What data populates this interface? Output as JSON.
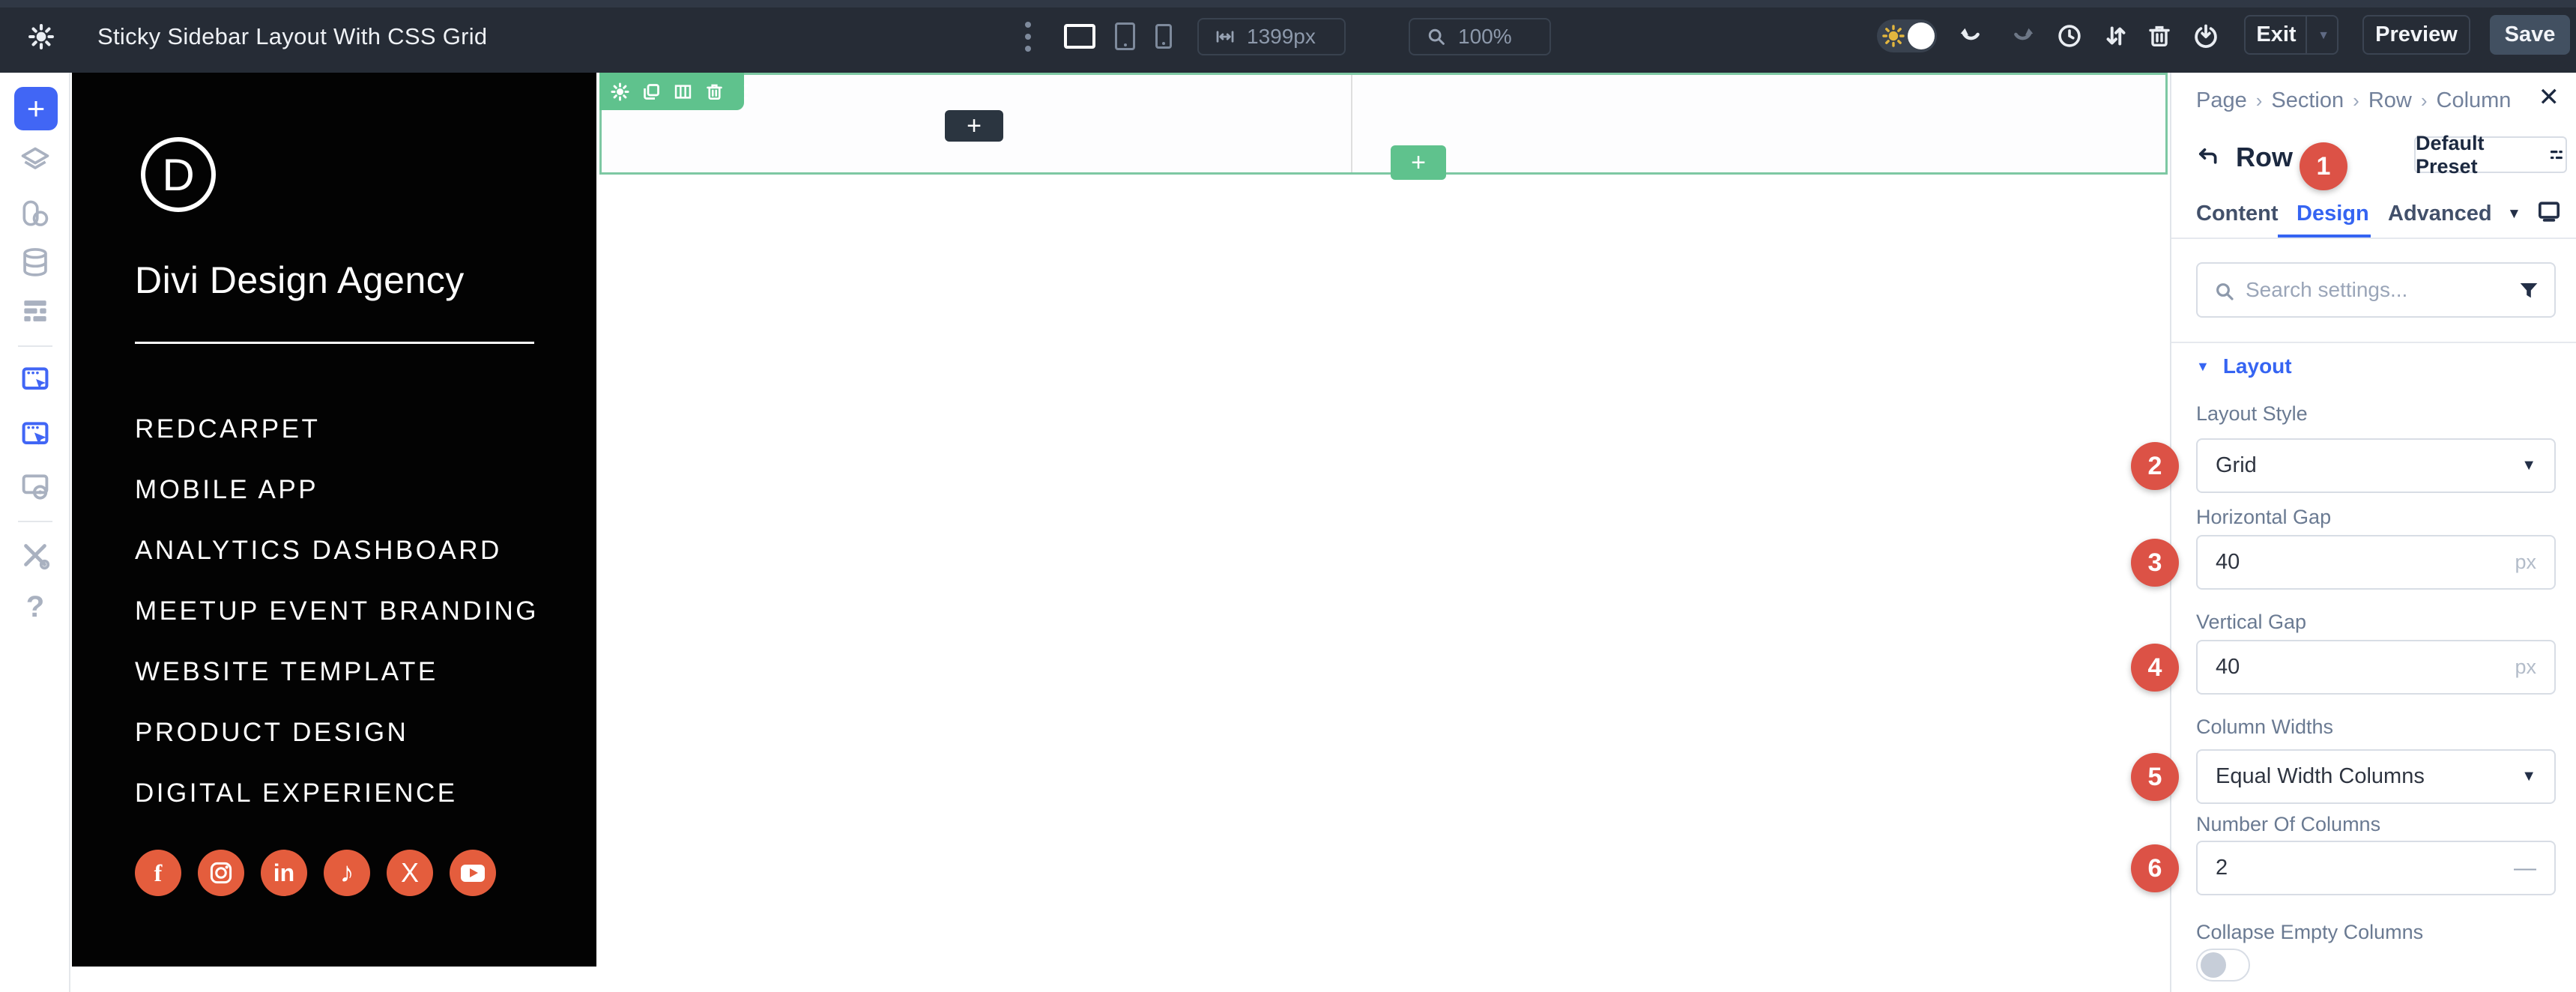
{
  "toolbar": {
    "title": "Sticky Sidebar Layout With CSS Grid",
    "width_value": "1399px",
    "zoom_value": "100%",
    "exit_label": "Exit",
    "preview_label": "Preview",
    "save_label": "Save"
  },
  "canvas": {
    "add_module_label": "+",
    "add_row_label": "+",
    "rail_add_label": "+",
    "sidebar": {
      "logo_letter": "D",
      "brand": "Divi Design Agency",
      "menu": [
        "REDCARPET",
        "MOBILE APP",
        "ANALYTICS DASHBOARD",
        "MEETUP EVENT BRANDING",
        "WEBSITE TEMPLATE",
        "PRODUCT DESIGN",
        "DIGITAL EXPERIENCE"
      ],
      "social": [
        "facebook",
        "instagram",
        "linkedin",
        "tiktok",
        "x",
        "youtube"
      ],
      "linkedin_text": "in",
      "facebook_text": "f",
      "x_text": "X",
      "tiktok_text": "♪"
    }
  },
  "panel": {
    "breadcrumb": {
      "items": [
        "Page",
        "Section",
        "Row",
        "Column"
      ],
      "separator": "›"
    },
    "close_glyph": "✕",
    "title": "Row",
    "preset_label": "Default Preset",
    "tabs": {
      "content": "Content",
      "design": "Design",
      "advanced": "Advanced",
      "active": "Design"
    },
    "tab_caret": "▼",
    "search_placeholder": "Search settings...",
    "layout_section": {
      "heading": "Layout",
      "heading_caret": "▼",
      "layout_style": {
        "label": "Layout Style",
        "value": "Grid",
        "caret": "▼"
      },
      "horizontal_gap": {
        "label": "Horizontal Gap",
        "value": "40",
        "unit": "px"
      },
      "vertical_gap": {
        "label": "Vertical Gap",
        "value": "40",
        "unit": "px"
      },
      "column_widths": {
        "label": "Column Widths",
        "value": "Equal Width Columns",
        "caret": "▼"
      },
      "number_of_columns": {
        "label": "Number Of Columns",
        "value": "2",
        "slider_dash": "—"
      },
      "collapse_empty_columns": {
        "label": "Collapse Empty Columns",
        "state": "off"
      }
    }
  },
  "badges": {
    "n1": "1",
    "n2": "2",
    "n3": "3",
    "n4": "4",
    "n5": "5",
    "n6": "6"
  },
  "colors": {
    "toolbar_bg": "#262c36",
    "accent_blue": "#3564f2",
    "row_green": "#5fc28d",
    "badge_red": "#dc5246",
    "social_orange": "#e45d3d",
    "save_button": "#425061",
    "sidebar_black": "#030303"
  }
}
